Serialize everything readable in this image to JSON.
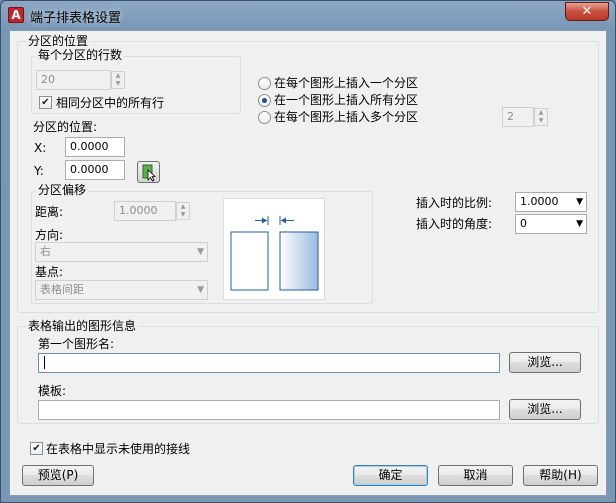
{
  "window": {
    "title": "端子排表格设置",
    "app_icon": "autocad-a-icon",
    "close_glyph": "✕"
  },
  "section_position": {
    "heading": "分区的位置",
    "rows_group": {
      "heading": "每个分区的行数",
      "rows_value": "20",
      "checkbox_label": "相同分区中的所有行",
      "checkbox_checked": true
    },
    "radios": [
      {
        "label": "在每个图形上插入一个分区",
        "selected": false
      },
      {
        "label": "在一个图形上插入所有分区",
        "selected": true
      },
      {
        "label": "在每个图形上插入多个分区",
        "selected": false
      }
    ],
    "multi_count": "2",
    "position_heading": "分区的位置:",
    "x_label": "X:",
    "x_value": "0.0000",
    "y_label": "Y:",
    "y_value": "0.0000",
    "pick_point_icon": "pick-point-icon"
  },
  "section_offset": {
    "heading": "分区偏移",
    "distance_label": "距离:",
    "distance_value": "1.0000",
    "direction_label": "方向:",
    "direction_value": "右",
    "basepoint_label": "基点:",
    "basepoint_value": "表格间距"
  },
  "insert": {
    "scale_label": "插入时的比例:",
    "scale_value": "1.0000",
    "angle_label": "插入时的角度:",
    "angle_value": "0"
  },
  "output": {
    "heading": "表格输出的图形信息",
    "first_drawing_label": "第一个图形名:",
    "first_drawing_value": "",
    "template_label": "模板:",
    "template_value": "",
    "browse_label": "浏览..."
  },
  "show_unused_checkbox": {
    "label": "在表格中显示未使用的接线",
    "checked": true
  },
  "buttons": {
    "preview": "预览(P)",
    "ok": "确定",
    "cancel": "取消",
    "help": "帮助(H)"
  },
  "colors": {
    "accent_radio": "#1e4c87",
    "preview_blue": "#1f5fa8",
    "close_red": "#c9503d"
  }
}
